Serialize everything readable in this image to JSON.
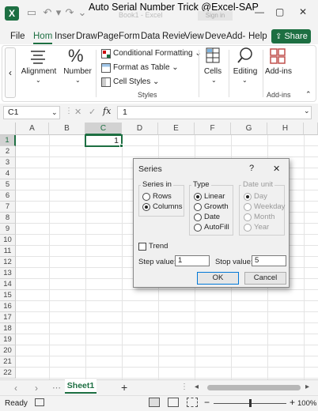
{
  "title_bar": {
    "title": "Auto Serial Number Trick @Excel-SAP",
    "ghost_title": "Book1 - Excel",
    "sign_in": "Sign in",
    "autosave_state": "Off"
  },
  "menu": {
    "tabs": [
      "File",
      "Hom",
      "Inser",
      "Draw",
      "Page",
      "Form",
      "Data",
      "Revie",
      "View",
      "Deve",
      "Add-",
      "Help"
    ],
    "active_tab": "Hom",
    "share_label": "Share"
  },
  "ribbon": {
    "collapse_label": "‹",
    "alignment": "Alignment",
    "number": "Number",
    "number_symbol": "%",
    "conditional_formatting": "Conditional Formatting",
    "format_as_table": "Format as Table",
    "cell_styles": "Cell Styles",
    "styles_group": "Styles",
    "cells": "Cells",
    "editing": "Editing",
    "add_ins": "Add-ins",
    "add_ins_group": "Add-ins"
  },
  "formula_bar": {
    "name_box": "C1",
    "cancel": "✕",
    "enter": "✓",
    "fx": "fx",
    "value": "1"
  },
  "grid": {
    "columns": [
      "A",
      "B",
      "C",
      "D",
      "E",
      "F",
      "G",
      "H"
    ],
    "rows": [
      "1",
      "2",
      "3",
      "4",
      "5",
      "6",
      "7",
      "8",
      "9",
      "10",
      "11",
      "12",
      "13",
      "14",
      "15",
      "16",
      "17",
      "18",
      "19",
      "20",
      "21",
      "22"
    ],
    "active_cell": "C1",
    "active_value": "1"
  },
  "dialog": {
    "title": "Series",
    "help": "?",
    "close": "✕",
    "series_in": {
      "title": "Series in",
      "options": [
        "Rows",
        "Columns"
      ],
      "selected": "Columns"
    },
    "type": {
      "title": "Type",
      "options": [
        "Linear",
        "Growth",
        "Date",
        "AutoFill"
      ],
      "selected": "Linear"
    },
    "date_unit": {
      "title": "Date unit",
      "options": [
        "Day",
        "Weekday",
        "Month",
        "Year"
      ],
      "selected": "Day",
      "disabled": true
    },
    "trend_label": "Trend",
    "trend_checked": false,
    "step_label": "Step value:",
    "step_value": "1",
    "stop_label": "Stop value:",
    "stop_value": "5",
    "ok": "OK",
    "cancel": "Cancel"
  },
  "sheet_tabs": {
    "nav_prev": "‹",
    "nav_next": "›",
    "ellipsis": "⋯",
    "active_sheet": "Sheet1",
    "add": "+"
  },
  "status_bar": {
    "ready": "Ready",
    "zoom": "100%",
    "zoom_level_fraction": 0.5
  },
  "colors": {
    "accent": "#1d6f42",
    "dialog_bg": "#f0f0f0",
    "default_button_border": "#0078d7"
  }
}
